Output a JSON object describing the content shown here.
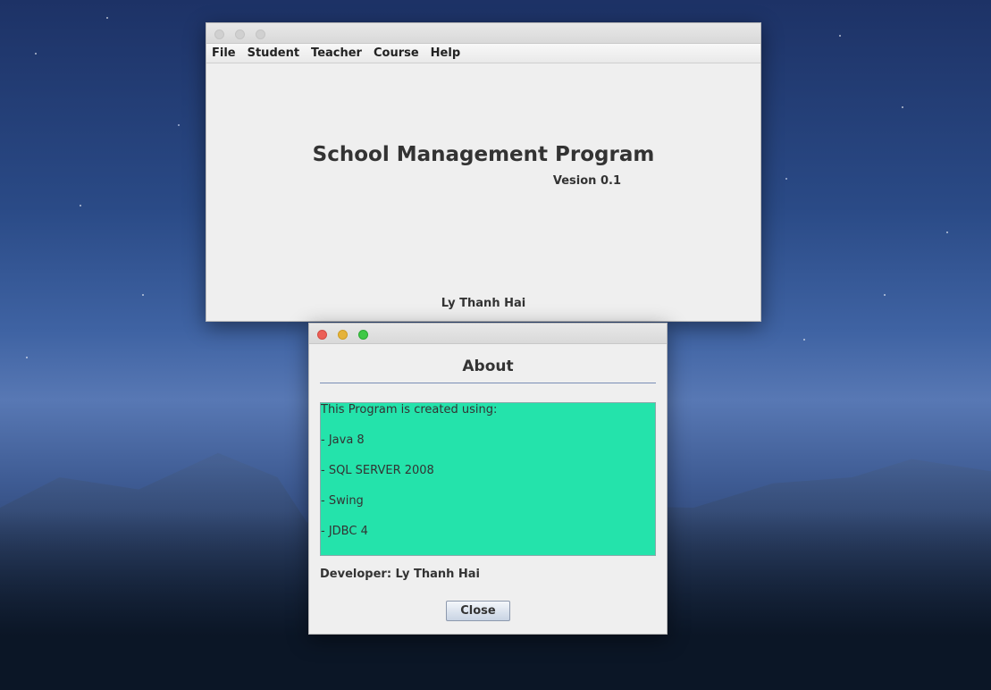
{
  "main_window": {
    "menu": [
      "File",
      "Student",
      "Teacher",
      "Course",
      "Help"
    ],
    "title": "School Management Program",
    "version": "Vesion 0.1",
    "author": "Ly Thanh Hai"
  },
  "about_dialog": {
    "title": "About",
    "info_lines": [
      "This Program is created using:",
      "- Java 8",
      "- SQL SERVER 2008",
      "- Swing",
      "- JDBC 4"
    ],
    "developer": "Developer: Ly Thanh Hai",
    "close_label": "Close",
    "info_bg_color": "#24e3ab"
  }
}
